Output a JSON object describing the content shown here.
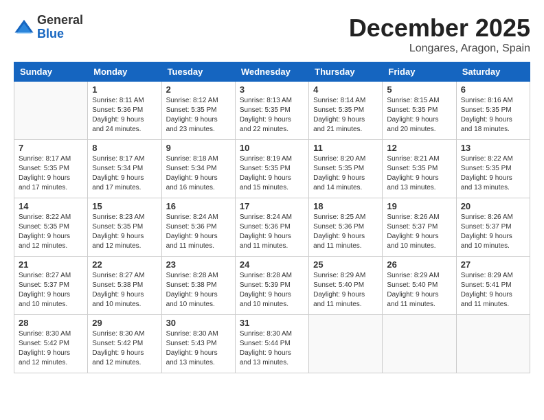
{
  "logo": {
    "general": "General",
    "blue": "Blue"
  },
  "title": {
    "month": "December 2025",
    "location": "Longares, Aragon, Spain"
  },
  "weekdays": [
    "Sunday",
    "Monday",
    "Tuesday",
    "Wednesday",
    "Thursday",
    "Friday",
    "Saturday"
  ],
  "weeks": [
    [
      {
        "day": "",
        "info": ""
      },
      {
        "day": "1",
        "info": "Sunrise: 8:11 AM\nSunset: 5:36 PM\nDaylight: 9 hours\nand 24 minutes."
      },
      {
        "day": "2",
        "info": "Sunrise: 8:12 AM\nSunset: 5:35 PM\nDaylight: 9 hours\nand 23 minutes."
      },
      {
        "day": "3",
        "info": "Sunrise: 8:13 AM\nSunset: 5:35 PM\nDaylight: 9 hours\nand 22 minutes."
      },
      {
        "day": "4",
        "info": "Sunrise: 8:14 AM\nSunset: 5:35 PM\nDaylight: 9 hours\nand 21 minutes."
      },
      {
        "day": "5",
        "info": "Sunrise: 8:15 AM\nSunset: 5:35 PM\nDaylight: 9 hours\nand 20 minutes."
      },
      {
        "day": "6",
        "info": "Sunrise: 8:16 AM\nSunset: 5:35 PM\nDaylight: 9 hours\nand 18 minutes."
      }
    ],
    [
      {
        "day": "7",
        "info": "Sunrise: 8:17 AM\nSunset: 5:35 PM\nDaylight: 9 hours\nand 17 minutes."
      },
      {
        "day": "8",
        "info": "Sunrise: 8:17 AM\nSunset: 5:34 PM\nDaylight: 9 hours\nand 17 minutes."
      },
      {
        "day": "9",
        "info": "Sunrise: 8:18 AM\nSunset: 5:34 PM\nDaylight: 9 hours\nand 16 minutes."
      },
      {
        "day": "10",
        "info": "Sunrise: 8:19 AM\nSunset: 5:35 PM\nDaylight: 9 hours\nand 15 minutes."
      },
      {
        "day": "11",
        "info": "Sunrise: 8:20 AM\nSunset: 5:35 PM\nDaylight: 9 hours\nand 14 minutes."
      },
      {
        "day": "12",
        "info": "Sunrise: 8:21 AM\nSunset: 5:35 PM\nDaylight: 9 hours\nand 13 minutes."
      },
      {
        "day": "13",
        "info": "Sunrise: 8:22 AM\nSunset: 5:35 PM\nDaylight: 9 hours\nand 13 minutes."
      }
    ],
    [
      {
        "day": "14",
        "info": "Sunrise: 8:22 AM\nSunset: 5:35 PM\nDaylight: 9 hours\nand 12 minutes."
      },
      {
        "day": "15",
        "info": "Sunrise: 8:23 AM\nSunset: 5:35 PM\nDaylight: 9 hours\nand 12 minutes."
      },
      {
        "day": "16",
        "info": "Sunrise: 8:24 AM\nSunset: 5:36 PM\nDaylight: 9 hours\nand 11 minutes."
      },
      {
        "day": "17",
        "info": "Sunrise: 8:24 AM\nSunset: 5:36 PM\nDaylight: 9 hours\nand 11 minutes."
      },
      {
        "day": "18",
        "info": "Sunrise: 8:25 AM\nSunset: 5:36 PM\nDaylight: 9 hours\nand 11 minutes."
      },
      {
        "day": "19",
        "info": "Sunrise: 8:26 AM\nSunset: 5:37 PM\nDaylight: 9 hours\nand 10 minutes."
      },
      {
        "day": "20",
        "info": "Sunrise: 8:26 AM\nSunset: 5:37 PM\nDaylight: 9 hours\nand 10 minutes."
      }
    ],
    [
      {
        "day": "21",
        "info": "Sunrise: 8:27 AM\nSunset: 5:37 PM\nDaylight: 9 hours\nand 10 minutes."
      },
      {
        "day": "22",
        "info": "Sunrise: 8:27 AM\nSunset: 5:38 PM\nDaylight: 9 hours\nand 10 minutes."
      },
      {
        "day": "23",
        "info": "Sunrise: 8:28 AM\nSunset: 5:38 PM\nDaylight: 9 hours\nand 10 minutes."
      },
      {
        "day": "24",
        "info": "Sunrise: 8:28 AM\nSunset: 5:39 PM\nDaylight: 9 hours\nand 10 minutes."
      },
      {
        "day": "25",
        "info": "Sunrise: 8:29 AM\nSunset: 5:40 PM\nDaylight: 9 hours\nand 11 minutes."
      },
      {
        "day": "26",
        "info": "Sunrise: 8:29 AM\nSunset: 5:40 PM\nDaylight: 9 hours\nand 11 minutes."
      },
      {
        "day": "27",
        "info": "Sunrise: 8:29 AM\nSunset: 5:41 PM\nDaylight: 9 hours\nand 11 minutes."
      }
    ],
    [
      {
        "day": "28",
        "info": "Sunrise: 8:30 AM\nSunset: 5:42 PM\nDaylight: 9 hours\nand 12 minutes."
      },
      {
        "day": "29",
        "info": "Sunrise: 8:30 AM\nSunset: 5:42 PM\nDaylight: 9 hours\nand 12 minutes."
      },
      {
        "day": "30",
        "info": "Sunrise: 8:30 AM\nSunset: 5:43 PM\nDaylight: 9 hours\nand 13 minutes."
      },
      {
        "day": "31",
        "info": "Sunrise: 8:30 AM\nSunset: 5:44 PM\nDaylight: 9 hours\nand 13 minutes."
      },
      {
        "day": "",
        "info": ""
      },
      {
        "day": "",
        "info": ""
      },
      {
        "day": "",
        "info": ""
      }
    ]
  ]
}
